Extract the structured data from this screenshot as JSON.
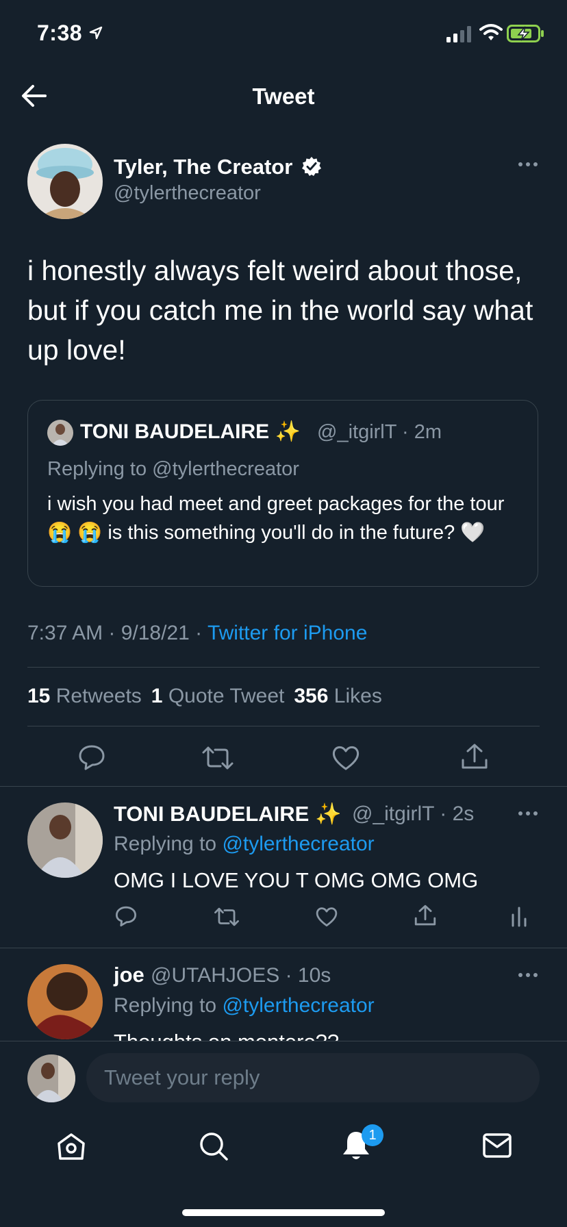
{
  "status_bar": {
    "time": "7:38"
  },
  "header": {
    "title": "Tweet"
  },
  "main_tweet": {
    "author_name": "Tyler, The Creator",
    "author_handle": "@tylerthecreator",
    "text": "i honestly always felt weird about those, but if you catch me in the world say what up love!",
    "timestamp": "7:37 AM · 9/18/21 · ",
    "source": "Twitter for iPhone",
    "quoted": {
      "name": "TONI BAUDELAIRE ✨",
      "handle_time": "@_itgirlT · 2m",
      "replying_to": "Replying to @tylerthecreator",
      "text": "i wish you had meet and greet packages for the tour 😭 😭 is this something you'll do in the future? 🤍"
    },
    "stats": {
      "retweets_count": "15",
      "retweets_label": "Retweets",
      "quotes_count": "1",
      "quotes_label": "Quote Tweet",
      "likes_count": "356",
      "likes_label": "Likes"
    }
  },
  "replies": [
    {
      "name": "TONI BAUDELAIRE ✨",
      "handle_time": "@_itgirlT · 2s",
      "replying_prefix": "Replying to ",
      "replying_handle": "@tylerthecreator",
      "text": "OMG I LOVE YOU T OMG OMG OMG"
    },
    {
      "name": "joe",
      "handle_time": "@UTAHJOES · 10s",
      "replying_prefix": "Replying to ",
      "replying_handle": "@tylerthecreator",
      "text": "Thoughts on montero??"
    }
  ],
  "compose": {
    "placeholder": "Tweet your reply"
  },
  "tab_bar": {
    "notification_count": "1"
  },
  "colors": {
    "background": "#15202b",
    "accent": "#1d9bf0",
    "muted": "#8b98a5",
    "divider": "#38444d"
  }
}
